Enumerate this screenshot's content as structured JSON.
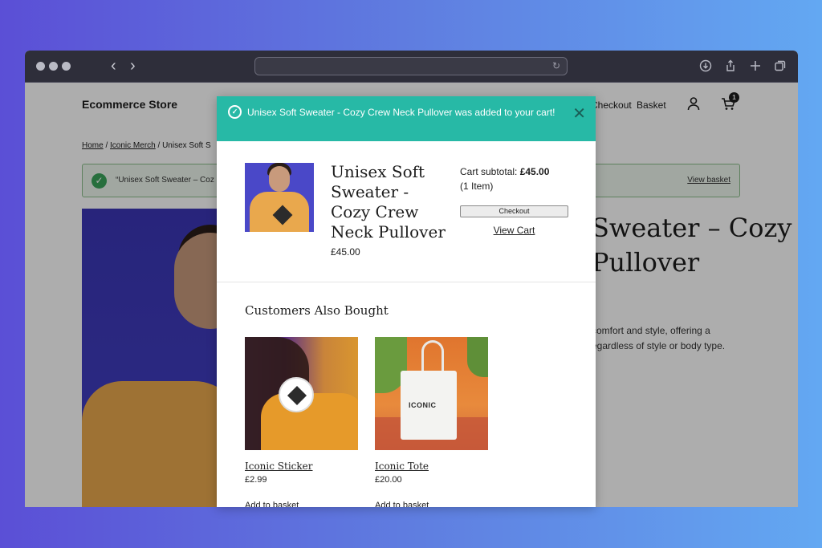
{
  "browser": {
    "icons": [
      "back-icon",
      "forward-icon",
      "reload-icon",
      "download-icon",
      "share-icon",
      "new-tab-icon",
      "tabs-icon"
    ]
  },
  "store": {
    "title": "Ecommerce Store",
    "nav": {
      "checkout": "Checkout",
      "basket": "Basket"
    },
    "cart_count": "1",
    "breadcrumb": {
      "home": "Home",
      "sep1": " / ",
      "category": "Iconic Merch",
      "sep2": " / ",
      "current": "Unisex Soft S"
    },
    "notice": {
      "message": "“Unisex Soft Sweater – Coz",
      "view_basket": "View basket"
    },
    "product_title": "Sweater – Cozy\nPullover",
    "description": "comfort and style, offering a\negardless of style or body type."
  },
  "modal": {
    "header_message": "Unisex Soft Sweater - Cozy Crew Neck Pullover was added to your cart!",
    "product_name": "Unisex Soft Sweater - Cozy Crew Neck Pullover",
    "product_price": "£45.00",
    "subtotal_label": "Cart subtotal: ",
    "subtotal_value": "£45.00",
    "item_count": "(1 Item)",
    "checkout_label": "Checkout",
    "view_cart_label": "View Cart",
    "also_bought_title": "Customers Also Bought",
    "products": [
      {
        "name": "Iconic Sticker",
        "price": "£2.99",
        "action": "Add to basket"
      },
      {
        "name": "Iconic Tote",
        "price": "£20.00",
        "action": "Add to basket",
        "bag_text": "ICONIC"
      }
    ]
  },
  "colors": {
    "accent": "#27b9a6",
    "success": "#3aa45a"
  }
}
